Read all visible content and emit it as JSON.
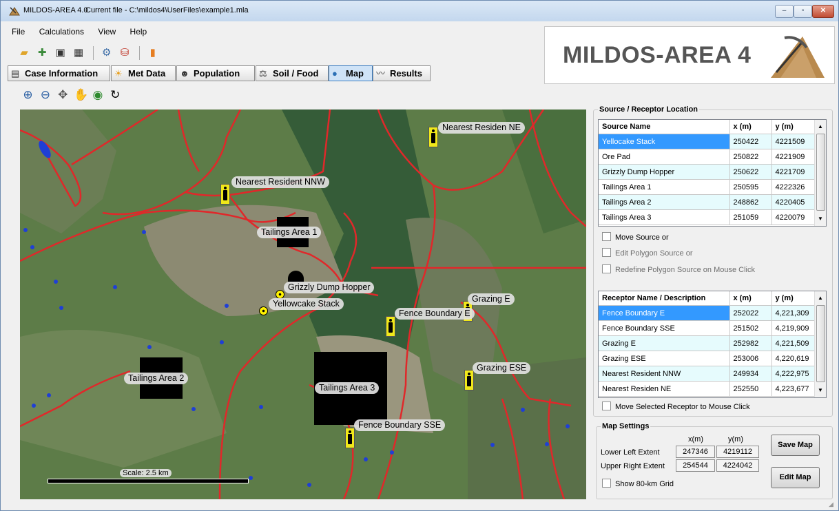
{
  "window": {
    "app_title": "MILDOS-AREA 4.0",
    "file_label": "Current file - C:\\mildos4\\UserFiles\\example1.mla",
    "minimize": "–",
    "maximize": "▫",
    "close": "✕"
  },
  "menu": [
    "File",
    "Calculations",
    "View",
    "Help"
  ],
  "tabs": [
    {
      "label": "Case Information",
      "icon": "document-icon"
    },
    {
      "label": "Met Data",
      "icon": "weather-icon"
    },
    {
      "label": "Population",
      "icon": "people-icon"
    },
    {
      "label": "Soil / Food",
      "icon": "scale-icon"
    },
    {
      "label": "Map",
      "icon": "globe-icon",
      "active": true
    },
    {
      "label": "Results",
      "icon": "chart-line-icon"
    }
  ],
  "logo": {
    "text": "MILDOS-AREA 4"
  },
  "map": {
    "labels": {
      "nearest_resident_nnw": "Nearest Resident NNW",
      "nearest_resident_ne": "Nearest Residen NE",
      "tailings_area_1": "Tailings Area 1",
      "grizzly_dump_hopper": "Grizzly Dump Hopper",
      "yellowcake_stack": "Yellowcake Stack",
      "fence_boundary_e": "Fence Boundary E",
      "grazing_e": "Grazing E",
      "grazing_ese": "Grazing ESE",
      "tailings_area_2": "Tailings Area 2",
      "tailings_area_3": "Tailings Area 3",
      "fence_boundary_sse": "Fence Boundary SSE"
    },
    "scale": "Scale: 2.5 km"
  },
  "source_panel": {
    "legend": "Source / Receptor Location",
    "columns": [
      "Source Name",
      "x (m)",
      "y (m)"
    ],
    "rows": [
      [
        "Yellocake Stack",
        "250422",
        "4221509"
      ],
      [
        "Ore Pad",
        "250822",
        "4221909"
      ],
      [
        "Grizzly Dump Hopper",
        "250622",
        "4221709"
      ],
      [
        "Tailings Area 1",
        "250595",
        "4222326"
      ],
      [
        "Tailings Area 2",
        "248862",
        "4220405"
      ],
      [
        "Tailings Area 3",
        "251059",
        "4220079"
      ]
    ],
    "move_source": "Move Source or",
    "edit_polygon": "Edit Polygon Source or",
    "redefine_polygon": "Redefine Polygon Source on Mouse Click"
  },
  "receptor_panel": {
    "columns": [
      "Receptor Name / Description",
      "x (m)",
      "y (m)"
    ],
    "rows": [
      [
        "Fence Boundary E",
        "252022",
        "4,221,309"
      ],
      [
        "Fence Boundary SSE",
        "251502",
        "4,219,909"
      ],
      [
        "Grazing E",
        "252982",
        "4,221,509"
      ],
      [
        "Grazing ESE",
        "253006",
        "4,220,619"
      ],
      [
        "Nearest Resident NNW",
        "249934",
        "4,222,975"
      ],
      [
        "Nearest Residen NE",
        "252550",
        "4,223,677"
      ]
    ],
    "move_receptor": "Move Selected Receptor to Mouse Click"
  },
  "map_settings": {
    "legend": "Map Settings",
    "xm": "x(m)",
    "ym": "y(m)",
    "lower_left_label": "Lower Left Extent",
    "lower_left_x": "247346",
    "lower_left_y": "4219112",
    "upper_right_label": "Upper Right Extent",
    "upper_right_x": "254544",
    "upper_right_y": "4224042",
    "show_grid": "Show 80-km Grid",
    "save_map": "Save Map",
    "edit_map": "Edit Map"
  }
}
